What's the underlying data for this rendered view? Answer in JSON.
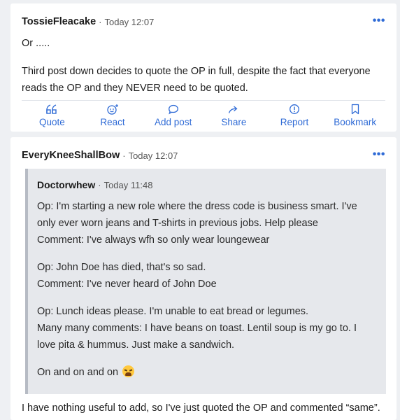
{
  "posts": [
    {
      "author": "TossieFleacake",
      "separator": "·",
      "time": "Today 12:07",
      "more": "•••",
      "paragraphs": [
        "Or .....",
        "Third post down decides to quote the OP in full, despite the fact that everyone reads the OP and they NEVER need to be quoted."
      ],
      "actions": [
        {
          "label": "Quote",
          "icon": "quote-icon"
        },
        {
          "label": "React",
          "icon": "react-icon"
        },
        {
          "label": "Add post",
          "icon": "speech-bubble-icon"
        },
        {
          "label": "Share",
          "icon": "share-arrow-icon"
        },
        {
          "label": "Report",
          "icon": "report-icon"
        },
        {
          "label": "Bookmark",
          "icon": "bookmark-icon"
        }
      ]
    },
    {
      "author": "EveryKneeShallBow",
      "separator": "·",
      "time": "Today 12:07",
      "more": "•••",
      "quote": {
        "author": "Doctorwhew",
        "separator": "·",
        "time": "Today 11:48",
        "lines": [
          "Op: I'm starting a new role where the dress code is business smart. I've only ever worn jeans and T-shirts in previous jobs. Help please",
          "Comment: I've always wfh so only wear loungewear",
          "Op: John Doe has died, that's so sad.",
          "Comment: I've never heard of John Doe",
          "Op: Lunch ideas please. I'm unable to eat bread or legumes.",
          "Many many comments: I have beans on toast. Lentil soup is my go to. I love pita & hummus. Just make a sandwich.",
          "On and on and on"
        ],
        "emoji": "weary-face-emoji"
      },
      "paragraphs": [
        "I have nothing useful to add, so I've just quoted the OP and commented “same”."
      ]
    }
  ],
  "colors": {
    "accent": "#2f6bd6",
    "page_background": "#eef0f3",
    "quote_background": "#e6e8ec",
    "quote_border": "#b6bbc4"
  }
}
